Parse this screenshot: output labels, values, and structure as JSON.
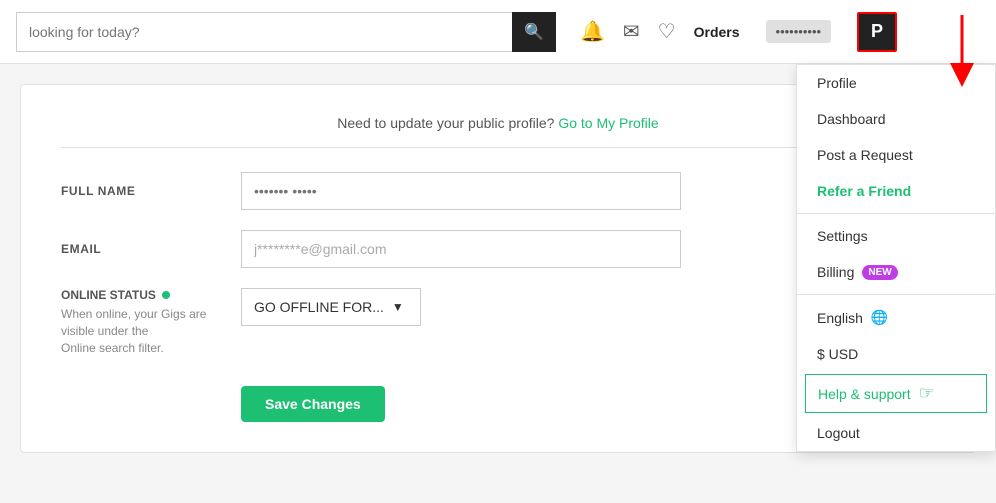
{
  "header": {
    "search_placeholder": "looking for today?",
    "search_button_icon": "🔍",
    "bell_icon": "🔔",
    "mail_icon": "✉",
    "heart_icon": "♡",
    "orders_label": "Orders",
    "user_tag": "••••••••••",
    "profile_letter": "P"
  },
  "notice": {
    "text": "Need to update your public profile?",
    "link_text": "Go to My Profile"
  },
  "form": {
    "full_name_label": "FULL NAME",
    "full_name_placeholder": "••••••• •••••",
    "email_label": "EMAIL",
    "email_value": "j********e@gmail.com",
    "online_status_label": "ONLINE STATUS",
    "online_desc_line1": "When online, your Gigs are visible under the",
    "online_desc_line2": "Online search filter.",
    "offline_button": "GO OFFLINE FOR...",
    "save_button": "Save Changes"
  },
  "dropdown": {
    "items": [
      {
        "label": "Profile",
        "type": "normal"
      },
      {
        "label": "Dashboard",
        "type": "normal"
      },
      {
        "label": "Post a Request",
        "type": "normal"
      },
      {
        "label": "Refer a Friend",
        "type": "green"
      },
      {
        "label": "Settings",
        "type": "normal"
      },
      {
        "label": "Billing",
        "type": "normal",
        "badge": "NEW"
      },
      {
        "label": "English",
        "type": "lang",
        "icon": "🌐"
      },
      {
        "label": "$ USD",
        "type": "normal"
      },
      {
        "label": "Help & support",
        "type": "help"
      },
      {
        "label": "Logout",
        "type": "normal"
      }
    ]
  }
}
